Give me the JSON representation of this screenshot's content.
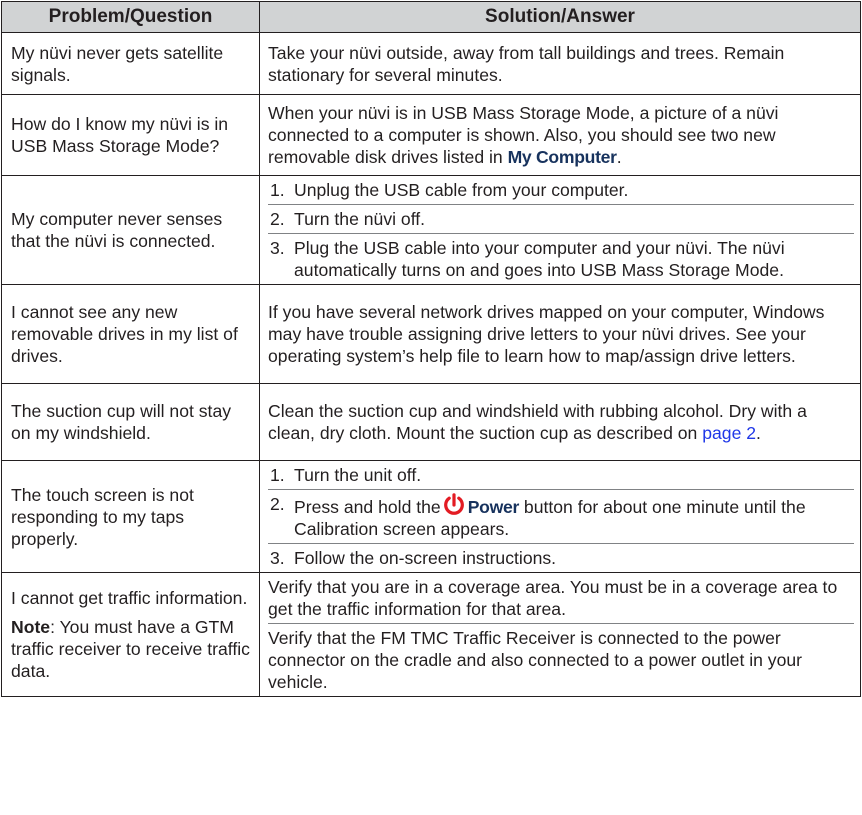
{
  "header": {
    "col1": "Problem/Question",
    "col2": "Solution/Answer"
  },
  "rows": {
    "r1": {
      "q": "My nüvi never gets satellite signals.",
      "a": "Take your nüvi outside, away from tall buildings and trees. Remain stationary for several minutes."
    },
    "r2": {
      "q": "How do I know my nüvi is in USB Mass Storage Mode?",
      "a_pre": "When your nüvi is in USB Mass Storage Mode, a picture of a nüvi connected to a computer is shown. Also, you should see two new removable disk drives listed in ",
      "a_term": "My Computer",
      "a_post": "."
    },
    "r3": {
      "q": "My computer never senses that the nüvi is connected.",
      "steps": [
        {
          "n": "1.",
          "text": "Unplug the USB cable from your computer."
        },
        {
          "n": "2.",
          "text": "Turn the nüvi off."
        },
        {
          "n": "3.",
          "text": "Plug the USB cable into your computer and your nüvi. The nüvi automatically turns on and goes into USB Mass Storage Mode."
        }
      ]
    },
    "r4": {
      "q": "I cannot see any new removable drives in my list of drives.",
      "a": "If you have several network drives mapped on your computer, Windows may have trouble assigning drive letters to your nüvi drives. See your operating system’s help file to learn how to map/assign drive letters."
    },
    "r5": {
      "q": "The suction cup will not stay on my windshield.",
      "a_pre": "Clean the suction cup and windshield with rubbing alcohol. Dry with a clean, dry cloth. Mount the suction cup as described on ",
      "a_link": "page 2",
      "a_post": "."
    },
    "r6": {
      "q": "The touch screen is not responding to my taps properly.",
      "s1_n": "1.",
      "s1": "Turn the unit off.",
      "s2_n": "2.",
      "s2_pre": "Press and hold the",
      "s2_term": "Power",
      "s2_post": " button for about one minute until the Calibration screen appears.",
      "s3_n": "3.",
      "s3": "Follow the on-screen instructions."
    },
    "r7": {
      "q1": "I cannot get traffic information.",
      "note_label": "Note",
      "note": ": You must have a GTM traffic receiver to receive traffic data.",
      "a1": "Verify that you are in a coverage area. You must be in a coverage area to get the traffic information for that area.",
      "a2": "Verify that the FM TMC Traffic Receiver is connected to the power connector on the cradle and also connected to a power outlet in your vehicle."
    }
  },
  "icons": {
    "power": "power-icon",
    "power_color": "#e31b23"
  }
}
